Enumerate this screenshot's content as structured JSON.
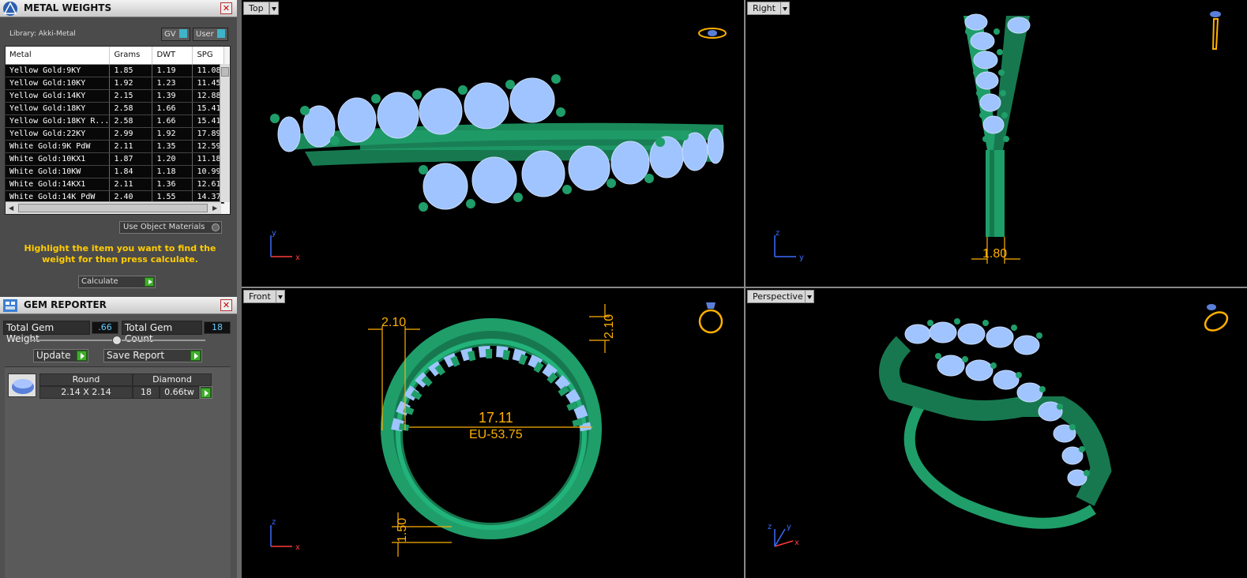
{
  "metal_weights": {
    "title": "METAL WEIGHTS",
    "library": "Library: Akki-Metal",
    "toggle_gv": "GV",
    "toggle_user": "User",
    "columns": [
      "Metal",
      "Grams",
      "DWT",
      "SPG"
    ],
    "rows": [
      [
        "Yellow Gold:9KY",
        "1.85",
        "1.19",
        "11.08"
      ],
      [
        "Yellow Gold:10KY",
        "1.92",
        "1.23",
        "11.45"
      ],
      [
        "Yellow Gold:14KY",
        "2.15",
        "1.39",
        "12.88"
      ],
      [
        "Yellow Gold:18KY",
        "2.58",
        "1.66",
        "15.41"
      ],
      [
        "Yellow Gold:18KY R...",
        "2.58",
        "1.66",
        "15.41"
      ],
      [
        "Yellow Gold:22KY",
        "2.99",
        "1.92",
        "17.89"
      ],
      [
        "White Gold:9K PdW",
        "2.11",
        "1.35",
        "12.59"
      ],
      [
        "White Gold:10KX1",
        "1.87",
        "1.20",
        "11.18"
      ],
      [
        "White Gold:10KW",
        "1.84",
        "1.18",
        "10.99"
      ],
      [
        "White Gold:14KX1",
        "2.11",
        "1.36",
        "12.61"
      ],
      [
        "White Gold:14K PdW",
        "2.40",
        "1.55",
        "14.37"
      ]
    ],
    "use_object_materials": "Use Object Materials",
    "hint": "Highlight the item you want to find the weight for then press calculate.",
    "calculate_label": "Calculate"
  },
  "gem_reporter": {
    "title": "GEM REPORTER",
    "total_gem_weight_label": "Total Gem Weight",
    "total_gem_weight": ".66",
    "total_gem_count_label": "Total Gem Count",
    "total_gem_count": "18",
    "update_label": "Update",
    "save_report_label": "Save Report",
    "gem": {
      "shape": "Round",
      "material": "Diamond",
      "size": "2.14 X 2.14",
      "count": "18",
      "weight": "0.66tw"
    }
  },
  "viewports": {
    "top": {
      "label": "Top"
    },
    "right": {
      "label": "Right",
      "dim": "1.80"
    },
    "front": {
      "label": "Front",
      "dim_width": "2.10",
      "dim_height": "2.10",
      "dim_inner": "17.11",
      "dim_size": "EU-53.75",
      "dim_band": "1.50"
    },
    "perspective": {
      "label": "Perspective"
    }
  },
  "axis": {
    "x": "x",
    "y": "y",
    "z": "z"
  },
  "colors": {
    "metal": "#1f9e6a",
    "gem": "#9fc4ff",
    "dimension": "#ffb000",
    "panel": "#4b4b4b"
  }
}
